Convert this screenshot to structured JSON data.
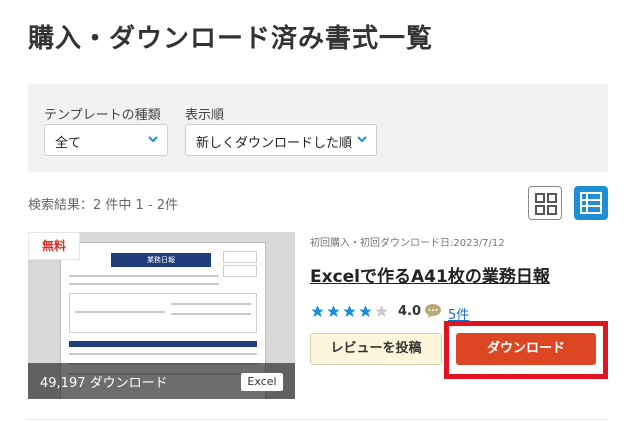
{
  "page": {
    "title": "購入・ダウンロード済み書式一覧"
  },
  "filters": {
    "template_type": {
      "label": "テンプレートの種類",
      "value": "全て"
    },
    "sort_order": {
      "label": "表示順",
      "value": "新しくダウンロードした順"
    }
  },
  "results": {
    "summary": "検索結果：2 件中 1 - 2件"
  },
  "view_toggle": {
    "active": "list",
    "accent_color": "#1e8fd6"
  },
  "items": [
    {
      "badge": "無料",
      "thumbnail_doc_title": "業務日報",
      "download_count": "49,197 ダウンロード",
      "file_type": "Excel",
      "purchase_meta": "初回購入・初回ダウンロード日:2023/7/12",
      "title": "Excelで作るA41枚の業務日報",
      "rating": 4.0,
      "rating_text": "4.0",
      "review_count": "5件",
      "review_button": "レビューを投稿",
      "download_button": "ダウンロード"
    }
  ],
  "colors": {
    "download": "#dd4622",
    "highlight": "#e0141e",
    "badge": "#d9322b",
    "link": "#1a6fbf"
  }
}
